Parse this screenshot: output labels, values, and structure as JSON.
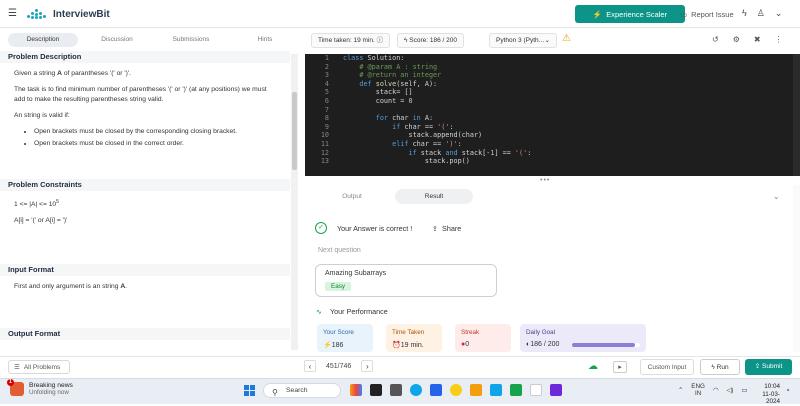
{
  "header": {
    "brand": "InterviewBit",
    "experience_button": "Experience Scaler",
    "report_issue": "Report Issue"
  },
  "left_tabs": [
    "Description",
    "Discussion",
    "Submissions",
    "Hints"
  ],
  "problem": {
    "desc_title": "Problem Description",
    "desc_p1_pre": "Given a string ",
    "desc_p1_bold": "A",
    "desc_p1_post": " of parantheses  '(' or ')'.",
    "desc_p2": "The task is to find minimum number of parentheses '(' or ')' (at any positions) we must add to make the resulting parentheses string valid.",
    "desc_p3": "An string is valid if:",
    "bullets": [
      "Open brackets must be closed by the corresponding closing bracket.",
      "Open brackets must be closed in the correct order."
    ],
    "constraints_title": "Problem Constraints",
    "constraint_1_pre": "1 <= |A| <= 10",
    "constraint_1_sup": "5",
    "constraint_2": "A[i] = '(' or A[i] = ')'",
    "input_title": "Input Format",
    "input_pre": "First and only argument is an string ",
    "input_bold": "A",
    "input_post": ".",
    "output_title": "Output Format"
  },
  "toolbar": {
    "time_taken": "Time taken: 19 min.",
    "score": "Score:  186  /  200",
    "language": "Python 3 (Pyth..."
  },
  "code_lines": [
    {
      "n": "1",
      "html": "<span class=\"kw\">class</span> Solution:"
    },
    {
      "n": "2",
      "html": "    <span class=\"cm\"># @param A : string</span>"
    },
    {
      "n": "3",
      "html": "    <span class=\"cm\"># @return an integer</span>"
    },
    {
      "n": "4",
      "html": "    <span class=\"kw\">def</span> <span class=\"fn\">solve</span>(self, A):"
    },
    {
      "n": "5",
      "html": "        stack= []"
    },
    {
      "n": "6",
      "html": "        count = <span class=\"nu\">0</span>"
    },
    {
      "n": "7",
      "html": ""
    },
    {
      "n": "8",
      "html": "        <span class=\"kw\">for</span> char <span class=\"kw\">in</span> A:"
    },
    {
      "n": "9",
      "html": "            <span class=\"kw\">if</span> char == <span class=\"st\">'('</span>:"
    },
    {
      "n": "10",
      "html": "                stack.append(char)"
    },
    {
      "n": "11",
      "html": "            <span class=\"kw\">elif</span> char == <span class=\"st\">')'</span>:"
    },
    {
      "n": "12",
      "html": "                <span class=\"kw\">if</span> stack <span class=\"kw\">and</span> stack[-<span class=\"nu\">1</span>] == <span class=\"st\">'('</span>:"
    },
    {
      "n": "13",
      "html": "                    stack.pop()"
    }
  ],
  "output_tabs": [
    "Output",
    "Result"
  ],
  "result": {
    "correct": "Your Answer is correct !",
    "share": "Share",
    "next_question": "Next question",
    "next_title": "Amazing Subarrays",
    "next_difficulty": "Easy",
    "performance": "Your Performance",
    "cards": [
      {
        "label": "Your Score",
        "value": "186",
        "icon": "⚡"
      },
      {
        "label": "Time Taken",
        "value": "19 min.",
        "icon": "⏰"
      },
      {
        "label": "Streak",
        "value": "0",
        "icon": "●"
      },
      {
        "label": "Daily Goal",
        "value": "186 / 200",
        "icon": "◐"
      }
    ],
    "daily_goal_fraction": 0.93
  },
  "bottom": {
    "all_problems": "All Problems",
    "pager": "451/746",
    "custom_input": "Custom Input",
    "run": "Run",
    "submit": "Submit"
  },
  "taskbar": {
    "news_title": "Breaking news",
    "news_sub": "Unfolding now",
    "news_badge": "1",
    "search": "Search",
    "lang1": "ENG",
    "lang2": "IN",
    "time": "10:04",
    "date": "11-03-2024"
  },
  "colors": {
    "accent": "#0d9488",
    "editor_bg": "#1e1e1e"
  }
}
